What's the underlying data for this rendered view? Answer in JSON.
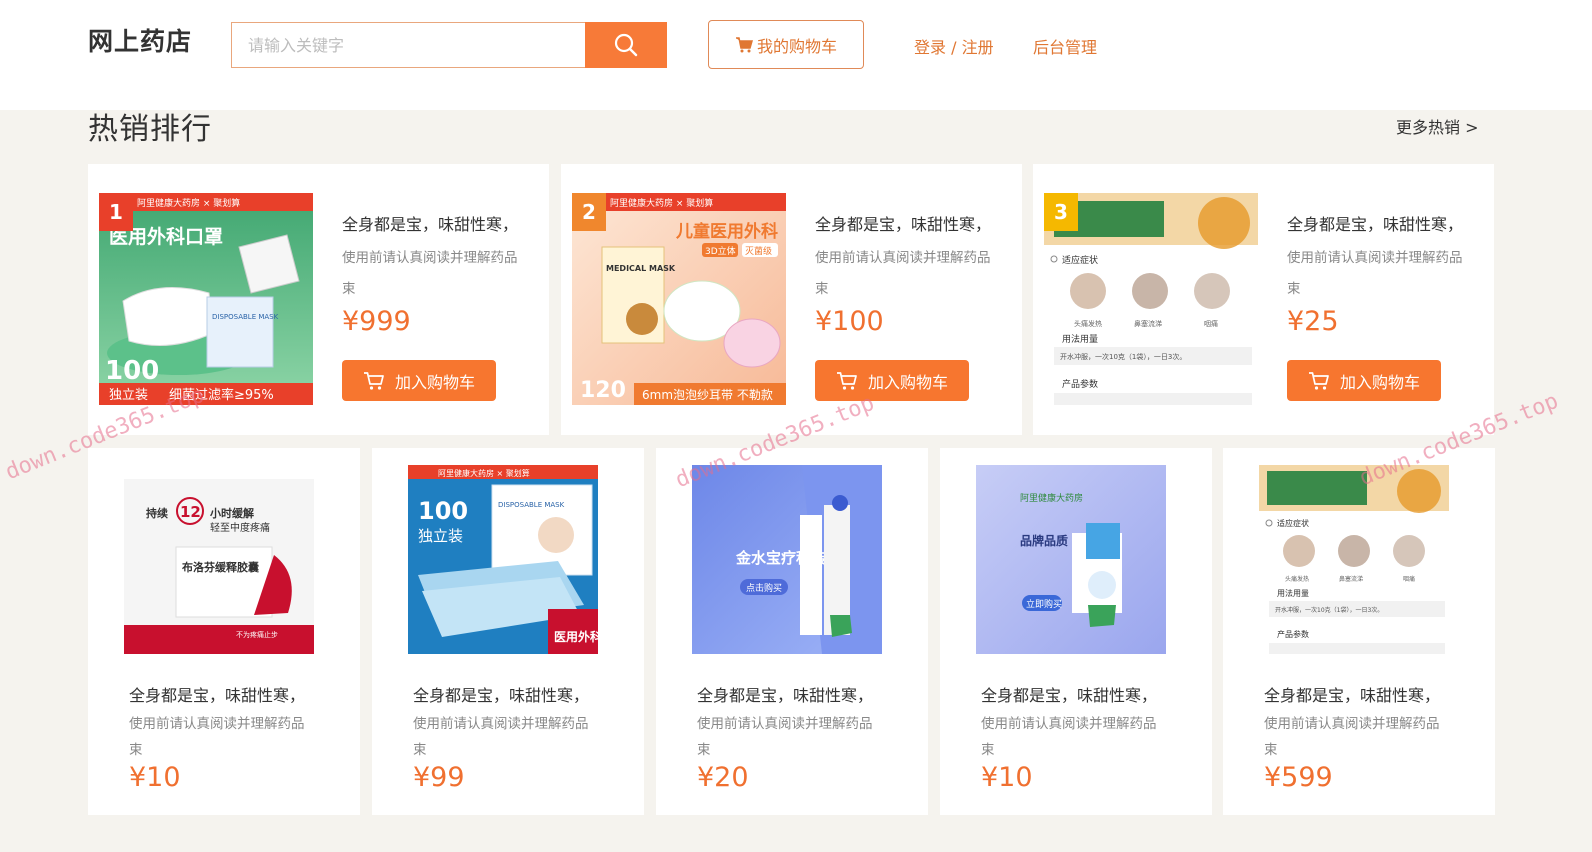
{
  "header": {
    "logo": "网上药店",
    "search_placeholder": "请输入关键字",
    "cart_label": "我的购物车",
    "login_label": "登录 / 注册",
    "admin_label": "后台管理"
  },
  "section": {
    "title": "热销排行",
    "more_label": "更多热销 >"
  },
  "top_products": [
    {
      "rank": "1",
      "rank_color": "#e8402a",
      "title": "全身都是宝，味甜性寒，",
      "desc": "使用前请认真阅读并理解药品",
      "desc2": "束",
      "price": "¥999",
      "add_label": "加入购物车",
      "img": {
        "brand": "阿里健康大药房 × 聚划算",
        "headline": "医用外科口罩",
        "badge_num": "100",
        "badge_text": "独立装",
        "footer": "细菌过滤率≥95%",
        "box": "DISPOSABLE MASK"
      }
    },
    {
      "rank": "2",
      "rank_color": "#f0872d",
      "title": "全身都是宝，味甜性寒，",
      "desc": "使用前请认真阅读并理解药品",
      "desc2": "束",
      "price": "¥100",
      "add_label": "加入购物车",
      "img": {
        "brand": "阿里健康大药房 × 聚划算",
        "headline": "儿童医用外科",
        "tag": "3D立体",
        "tag2": "灭菌级",
        "box": "MEDICAL MASK",
        "badge_num": "120",
        "footer": "6mm泡泡纱耳带 不勒款"
      }
    },
    {
      "rank": "3",
      "rank_color": "#f5b800",
      "title": "全身都是宝，味甜性寒，",
      "desc": "使用前请认真阅读并理解药品",
      "desc2": "束",
      "price": "¥25",
      "add_label": "加入购物车",
      "img": {
        "section1": "适应症状",
        "sym1": "头痛发热",
        "sym2": "鼻塞流涕",
        "sym3": "咽痛",
        "section2": "用法用量",
        "usage": "开水冲服，一次10克（1袋），一日3次。",
        "section3": "产品参数"
      }
    }
  ],
  "bottom_products": [
    {
      "title": "全身都是宝，味甜性寒，",
      "desc": "使用前请认真阅读并理解药品",
      "desc2": "束",
      "price": "¥10",
      "img": {
        "l1": "持续",
        "l2": "12",
        "l3": "小时缓解",
        "l4": "轻至中度疼痛",
        "product": "布洛芬缓释胶囊",
        "footer": "不为疼痛止步"
      }
    },
    {
      "title": "全身都是宝，味甜性寒，",
      "desc": "使用前请认真阅读并理解药品",
      "desc2": "束",
      "price": "¥99",
      "img": {
        "brand": "阿里健康大药房 × 聚划算",
        "badge_num": "100",
        "badge_text": "独立装",
        "box": "DISPOSABLE MASK",
        "corner": "医用外科"
      }
    },
    {
      "title": "全身都是宝，味甜性寒，",
      "desc": "使用前请认真阅读并理解药品",
      "desc2": "束",
      "price": "¥20",
      "img": {
        "l1": "金水宝疗程装",
        "btn": "点击购买"
      }
    },
    {
      "title": "全身都是宝，味甜性寒，",
      "desc": "使用前请认真阅读并理解药品",
      "desc2": "束",
      "price": "¥10",
      "img": {
        "brand": "阿里健康大药房",
        "l1": "品牌品质 星鲨D",
        "btn": "立即购买"
      }
    },
    {
      "title": "全身都是宝，味甜性寒，",
      "desc": "使用前请认真阅读并理解药品",
      "desc2": "束",
      "price": "¥599",
      "img": {
        "section1": "适应症状",
        "sym1": "头痛发热",
        "sym2": "鼻塞流涕",
        "sym3": "咽痛",
        "section2": "用法用量",
        "usage": "开水冲服，一次10克（1袋），一日3次。",
        "section3": "产品参数"
      }
    }
  ],
  "watermark": "down.code365.top",
  "colors": {
    "accent": "#f7762f",
    "price": "#f07030",
    "page_bg": "#f5f3ee"
  }
}
